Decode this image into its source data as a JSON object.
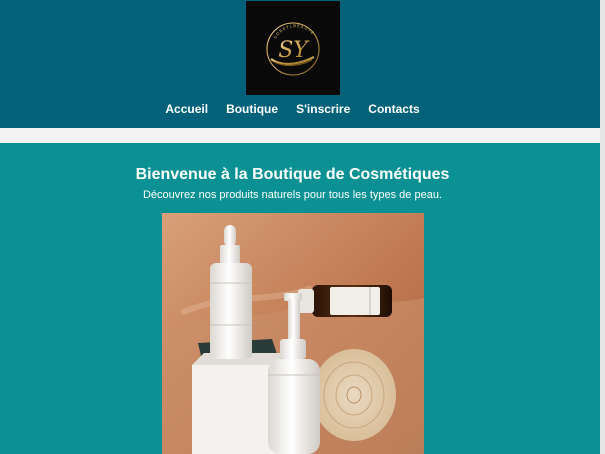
{
  "header": {
    "logo": {
      "monogram": "SY",
      "ring_text": "SOREYLBEAUTE"
    },
    "nav": [
      {
        "label": "Accueil"
      },
      {
        "label": "Boutique"
      },
      {
        "label": "S'inscrire"
      },
      {
        "label": "Contacts"
      }
    ]
  },
  "hero": {
    "title": "Bienvenue à la Boutique de Cosmétiques",
    "subtitle": "Découvrez nos produits naturels pour tous les types de peau."
  },
  "colors": {
    "header_bg": "#04617a",
    "hero_bg": "#0b9193",
    "logo_gold": "#c9a04a",
    "strip_bg": "#f3f3f3"
  }
}
